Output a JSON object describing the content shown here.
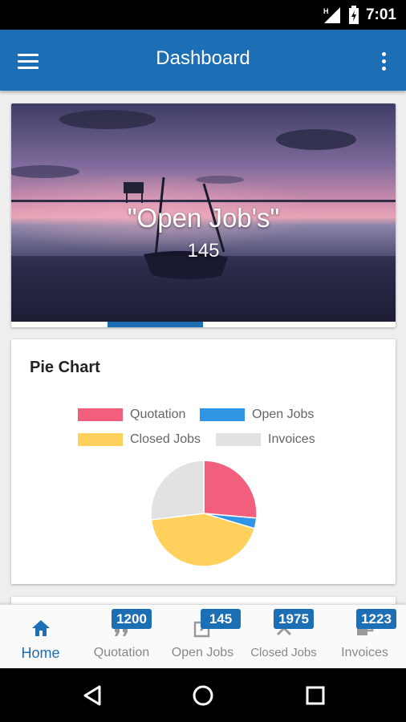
{
  "status_bar": {
    "time": "7:01",
    "network_badge": "H",
    "icons": [
      "signal-icon",
      "battery-charging-icon"
    ]
  },
  "app_bar": {
    "title": "Dashboard",
    "menu_icon": "hamburger-menu-icon",
    "more_icon": "more-vert-icon"
  },
  "hero": {
    "label": "\"Open Job's\"",
    "value": "145",
    "active_page": 2,
    "page_count": 4
  },
  "pie_card": {
    "title": "Pie Chart"
  },
  "chart_data": {
    "type": "pie",
    "title": "",
    "legend": [
      "Quotation",
      "Open Jobs",
      "Closed Jobs",
      "Invoices"
    ],
    "legend_placement": "top",
    "slices": [
      {
        "label": "Quotation",
        "value": 1200,
        "color": "#f25f7c"
      },
      {
        "label": "Open Jobs",
        "value": 145,
        "color": "#2f96e5"
      },
      {
        "label": "Closed Jobs",
        "value": 1975,
        "color": "#ffd15c"
      },
      {
        "label": "Invoices",
        "value": 1223,
        "color": "#e2e2e2"
      }
    ]
  },
  "bottom_nav": {
    "items": [
      {
        "label": "Home",
        "icon": "home-icon",
        "badge": ""
      },
      {
        "label": "Quotation",
        "icon": "quote-icon",
        "badge": "1200"
      },
      {
        "label": "Open Jobs",
        "icon": "open-job-icon",
        "badge": "145"
      },
      {
        "label": "Closed Jobs",
        "icon": "close-icon",
        "badge": "1975"
      },
      {
        "label": "Invoices",
        "icon": "invoice-icon",
        "badge": "1223"
      }
    ],
    "active_index": 0
  },
  "system_nav": {
    "icons": [
      "back-icon",
      "home-circle-icon",
      "recents-icon"
    ]
  },
  "colors": {
    "primary": "#1d6fb5",
    "status_bar": "#000000",
    "background": "#eeeeee"
  }
}
